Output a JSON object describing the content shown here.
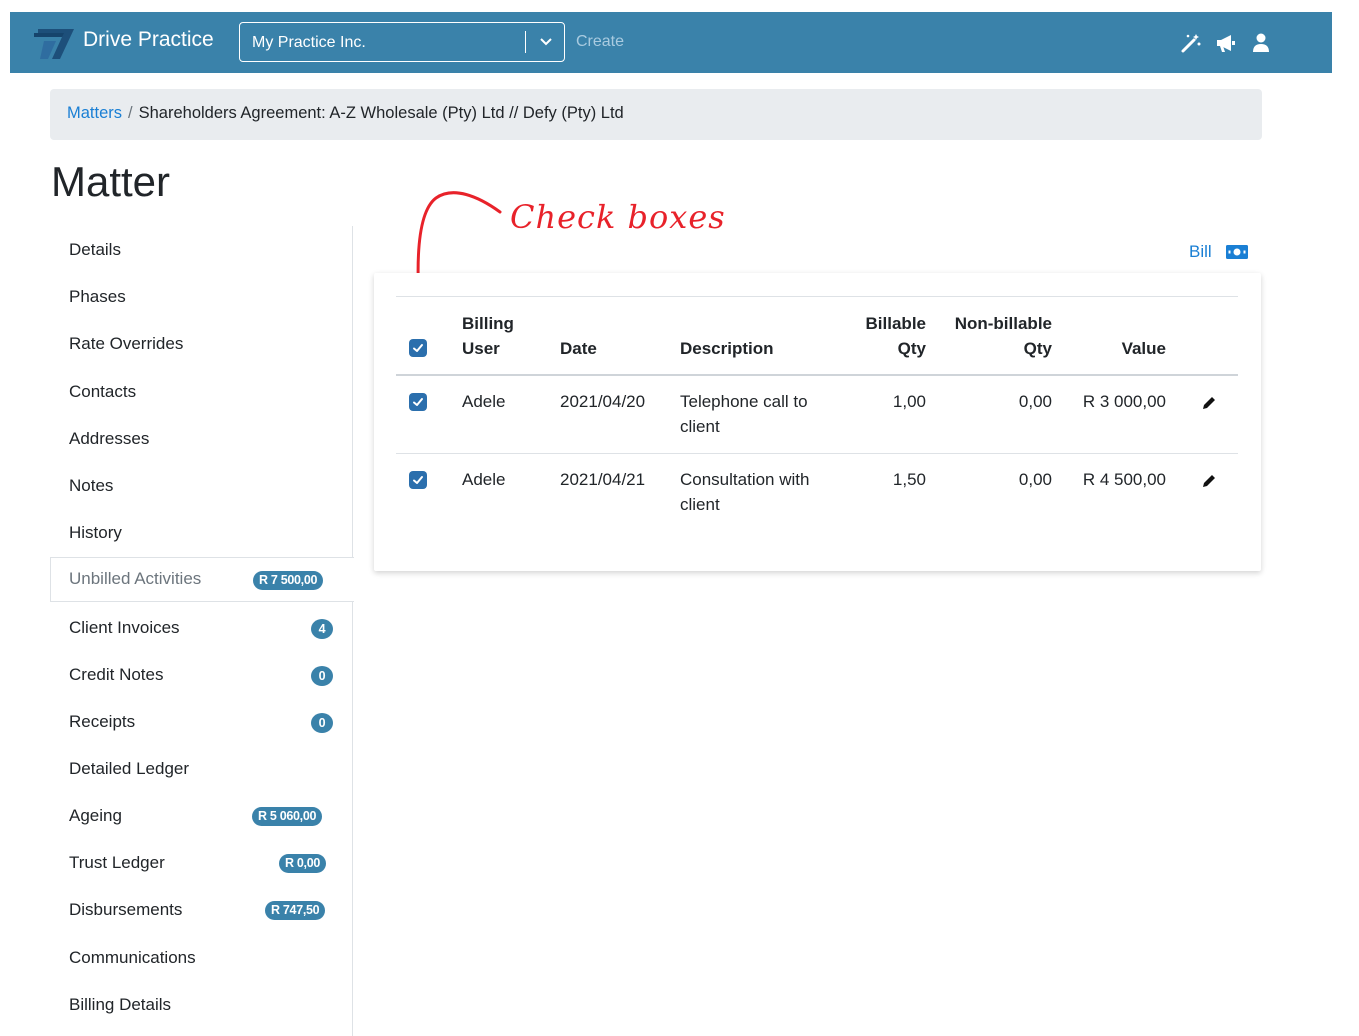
{
  "app": {
    "brand": "Drive Practice",
    "org_selected": "My Practice Inc.",
    "create_label": "Create",
    "accent_color": "#3a82aa",
    "nav_icons": [
      "magic-wand-icon",
      "megaphone-icon",
      "user-icon"
    ]
  },
  "breadcrumb": {
    "parent": "Matters",
    "separator": "/",
    "current": "Shareholders Agreement: A-Z Wholesale (Pty) Ltd // Defy (Pty) Ltd"
  },
  "page_title": "Matter",
  "sidebar": {
    "items": [
      {
        "label": "Details",
        "badge": ""
      },
      {
        "label": "Phases",
        "badge": ""
      },
      {
        "label": "Rate Overrides",
        "badge": ""
      },
      {
        "label": "Contacts",
        "badge": ""
      },
      {
        "label": "Addresses",
        "badge": ""
      },
      {
        "label": "Notes",
        "badge": ""
      },
      {
        "label": "History",
        "badge": ""
      },
      {
        "label": "Unbilled Activities",
        "badge": "R 7 500,00",
        "active": true
      },
      {
        "label": "Client Invoices",
        "badge": "4"
      },
      {
        "label": "Credit Notes",
        "badge": "0"
      },
      {
        "label": "Receipts",
        "badge": "0"
      },
      {
        "label": "Detailed Ledger",
        "badge": ""
      },
      {
        "label": "Ageing",
        "badge": "R 5 060,00"
      },
      {
        "label": "Trust Ledger",
        "badge": "R 0,00"
      },
      {
        "label": "Disbursements",
        "badge": "R 747,50"
      },
      {
        "label": "Communications",
        "badge": ""
      },
      {
        "label": "Billing Details",
        "badge": ""
      }
    ]
  },
  "annotation": {
    "text": "Check boxes",
    "color": "#e8222a"
  },
  "bill_label": "Bill",
  "table": {
    "headers": {
      "billing_user_1": "Billing",
      "billing_user_2": "User",
      "date": "Date",
      "description": "Description",
      "billable_1": "Billable",
      "billable_2": "Qty",
      "nonbillable_1": "Non-billable",
      "nonbillable_2": "Qty",
      "value": "Value"
    },
    "select_all_checked": true,
    "rows": [
      {
        "checked": true,
        "user": "Adele",
        "date": "2021/04/20",
        "desc_1": "Telephone call to",
        "desc_2": "client",
        "billable": "1,00",
        "nonbillable": "0,00",
        "value": "R 3 000,00"
      },
      {
        "checked": true,
        "user": "Adele",
        "date": "2021/04/21",
        "desc_1": "Consultation with",
        "desc_2": "client",
        "billable": "1,50",
        "nonbillable": "0,00",
        "value": "R 4 500,00"
      }
    ]
  }
}
